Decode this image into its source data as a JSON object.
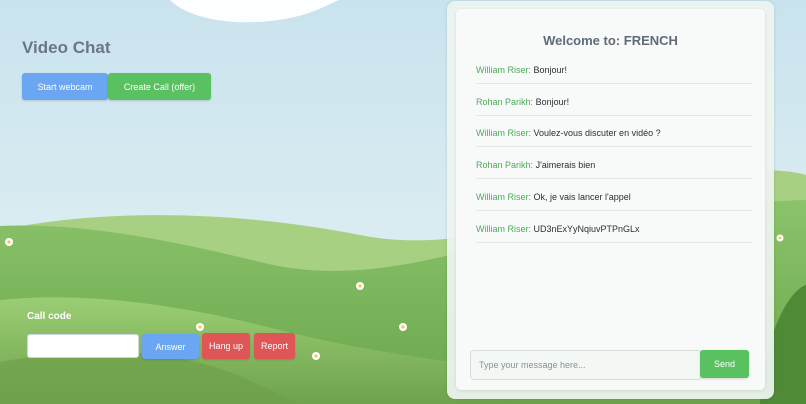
{
  "page": {
    "title": "Video Chat"
  },
  "controls": {
    "start_webcam_label": "Start webcam",
    "create_call_label": "Create Call (offer)"
  },
  "call": {
    "code_label": "Call code",
    "code_value": "",
    "answer_label": "Answer",
    "hangup_label": "Hang up",
    "report_label": "Report"
  },
  "chat": {
    "welcome_prefix": "Welcome to:",
    "room": "FRENCH",
    "messages": [
      {
        "sender": "William Riser:",
        "text": "Bonjour!"
      },
      {
        "sender": "Rohan Parikh:",
        "text": "Bonjour!"
      },
      {
        "sender": "William Riser:",
        "text": "Voulez-vous discuter en vidéo ?"
      },
      {
        "sender": "Rohan Parikh:",
        "text": "J'aimerais bien"
      },
      {
        "sender": "William Riser:",
        "text": "Ok, je vais lancer l'appel"
      },
      {
        "sender": "William Riser:",
        "text": "UD3nExYyNqiuvPTPnGLx"
      }
    ],
    "input_placeholder": "Type your message here...",
    "input_value": "",
    "send_label": "Send"
  },
  "colors": {
    "primary_blue": "#6ba6f2",
    "success_green": "#59c160",
    "danger_red": "#e05555",
    "sender_green": "#4fa95a",
    "sky": "#cfe6ef",
    "grass": "#7fb55a"
  },
  "icons": [
    "daisy-flower-icon"
  ]
}
